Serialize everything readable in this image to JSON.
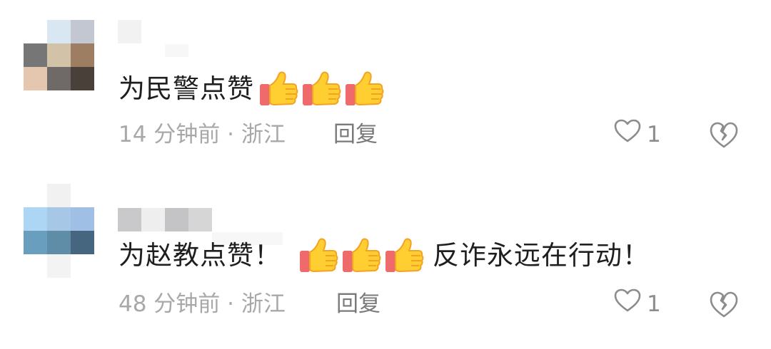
{
  "comments": [
    {
      "text": "为民警点赞",
      "text_after": "",
      "thumbs": [
        "thumbs-up-icon",
        "thumbs-up-icon",
        "thumbs-up-icon"
      ],
      "time_location": "14 分钟前 · 浙江",
      "reply_label": "回复",
      "likes": "1",
      "avatar_colors": [
        "#ffffff",
        "#d9e7f3",
        "#c3c7d1",
        "#767676",
        "#d2c2a8",
        "#9d7e62",
        "#e4c7ae",
        "#6f6a67",
        "#4a403a"
      ]
    },
    {
      "text": "为赵教点赞！",
      "text_after": "反诈永远在行动！",
      "thumbs": [
        "thumbs-up-icon",
        "thumbs-up-icon",
        "thumbs-up-icon"
      ],
      "time_location": "48 分钟前 · 浙江",
      "reply_label": "回复",
      "likes": "1",
      "avatar_colors": [
        "#ffffff",
        "#f1f1f1",
        "#ffffff",
        "#acd6f3",
        "#a7c7e6",
        "#9fc0e4",
        "#6a9ebf",
        "#5f8da8",
        "#46657e",
        "#ffffff",
        "#f3f3f3",
        "#ffffff"
      ]
    }
  ],
  "colors": {
    "thumb_yellow": "#ffce31",
    "thumb_outline": "#f4a223",
    "cuff_pink": "#ef6a6a",
    "meta_gray": "#a8a8a8",
    "icon_gray": "#8c8c8c"
  }
}
